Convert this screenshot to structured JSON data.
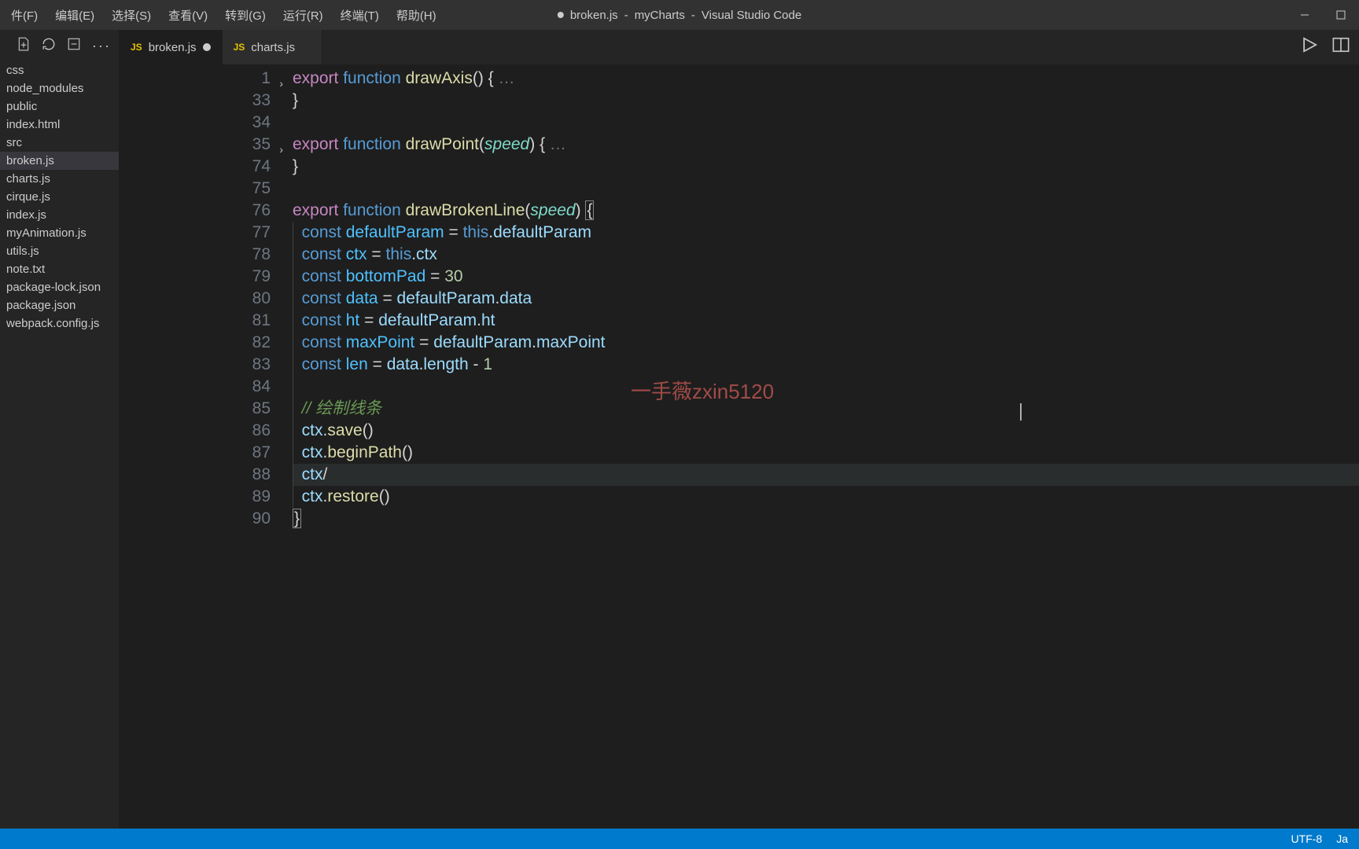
{
  "window": {
    "title_file": "broken.js",
    "title_project": "myCharts",
    "title_app": "Visual Studio Code",
    "dirty": true
  },
  "menu": [
    "件(F)",
    "编辑(E)",
    "选择(S)",
    "查看(V)",
    "转到(G)",
    "运行(R)",
    "终端(T)",
    "帮助(H)"
  ],
  "sidebar": {
    "files": [
      "css",
      "node_modules",
      "public",
      "  index.html",
      "src",
      "  broken.js",
      "  charts.js",
      "  cirque.js",
      "  index.js",
      "  myAnimation.js",
      "  utils.js",
      "note.txt",
      "package-lock.json",
      "package.json",
      "webpack.config.js"
    ],
    "active_index": 5
  },
  "tabs": [
    {
      "icon": "JS",
      "label": "broken.js",
      "dirty": true,
      "active": true
    },
    {
      "icon": "JS",
      "label": "charts.js",
      "dirty": false,
      "active": false
    }
  ],
  "code": {
    "lines": [
      {
        "num": 1,
        "fold": true,
        "tokens": [
          {
            "c": "kw",
            "t": "export"
          },
          {
            "c": "plain",
            "t": " "
          },
          {
            "c": "kw2",
            "t": "function"
          },
          {
            "c": "plain",
            "t": " "
          },
          {
            "c": "fn",
            "t": "drawAxis"
          },
          {
            "c": "punct",
            "t": "()"
          },
          {
            "c": "plain",
            "t": " "
          },
          {
            "c": "punct",
            "t": "{"
          },
          {
            "c": "fold",
            "t": " …"
          }
        ]
      },
      {
        "num": 33,
        "tokens": [
          {
            "c": "punct",
            "t": "}"
          }
        ]
      },
      {
        "num": 34,
        "tokens": []
      },
      {
        "num": 35,
        "fold": true,
        "tokens": [
          {
            "c": "kw",
            "t": "export"
          },
          {
            "c": "plain",
            "t": " "
          },
          {
            "c": "kw2",
            "t": "function"
          },
          {
            "c": "plain",
            "t": " "
          },
          {
            "c": "fn",
            "t": "drawPoint"
          },
          {
            "c": "punct",
            "t": "("
          },
          {
            "c": "param",
            "t": "speed"
          },
          {
            "c": "punct",
            "t": ")"
          },
          {
            "c": "plain",
            "t": " "
          },
          {
            "c": "punct",
            "t": "{"
          },
          {
            "c": "fold",
            "t": " …"
          }
        ]
      },
      {
        "num": 74,
        "tokens": [
          {
            "c": "punct",
            "t": "}"
          }
        ]
      },
      {
        "num": 75,
        "tokens": []
      },
      {
        "num": 76,
        "tokens": [
          {
            "c": "kw",
            "t": "export"
          },
          {
            "c": "plain",
            "t": " "
          },
          {
            "c": "kw2",
            "t": "function"
          },
          {
            "c": "plain",
            "t": " "
          },
          {
            "c": "fn",
            "t": "drawBrokenLine"
          },
          {
            "c": "punct",
            "t": "("
          },
          {
            "c": "param",
            "t": "speed"
          },
          {
            "c": "punct",
            "t": ")"
          },
          {
            "c": "plain",
            "t": " "
          },
          {
            "c": "punct",
            "t": "{",
            "hl": true
          }
        ]
      },
      {
        "num": 77,
        "indent": 1,
        "tokens": [
          {
            "c": "plain",
            "t": "  "
          },
          {
            "c": "kw2",
            "t": "const"
          },
          {
            "c": "plain",
            "t": " "
          },
          {
            "c": "var",
            "t": "defaultParam"
          },
          {
            "c": "plain",
            "t": " "
          },
          {
            "c": "op",
            "t": "="
          },
          {
            "c": "plain",
            "t": " "
          },
          {
            "c": "this",
            "t": "this"
          },
          {
            "c": "punct",
            "t": "."
          },
          {
            "c": "prop",
            "t": "defaultParam"
          }
        ]
      },
      {
        "num": 78,
        "indent": 1,
        "tokens": [
          {
            "c": "plain",
            "t": "  "
          },
          {
            "c": "kw2",
            "t": "const"
          },
          {
            "c": "plain",
            "t": " "
          },
          {
            "c": "var",
            "t": "ctx"
          },
          {
            "c": "plain",
            "t": " "
          },
          {
            "c": "op",
            "t": "="
          },
          {
            "c": "plain",
            "t": " "
          },
          {
            "c": "this",
            "t": "this"
          },
          {
            "c": "punct",
            "t": "."
          },
          {
            "c": "prop",
            "t": "ctx"
          }
        ]
      },
      {
        "num": 79,
        "indent": 1,
        "tokens": [
          {
            "c": "plain",
            "t": "  "
          },
          {
            "c": "kw2",
            "t": "const"
          },
          {
            "c": "plain",
            "t": " "
          },
          {
            "c": "var",
            "t": "bottomPad"
          },
          {
            "c": "plain",
            "t": " "
          },
          {
            "c": "op",
            "t": "="
          },
          {
            "c": "plain",
            "t": " "
          },
          {
            "c": "num",
            "t": "30"
          }
        ]
      },
      {
        "num": 80,
        "indent": 1,
        "tokens": [
          {
            "c": "plain",
            "t": "  "
          },
          {
            "c": "kw2",
            "t": "const"
          },
          {
            "c": "plain",
            "t": " "
          },
          {
            "c": "var",
            "t": "data"
          },
          {
            "c": "plain",
            "t": " "
          },
          {
            "c": "op",
            "t": "="
          },
          {
            "c": "plain",
            "t": " "
          },
          {
            "c": "prop",
            "t": "defaultParam"
          },
          {
            "c": "punct",
            "t": "."
          },
          {
            "c": "prop",
            "t": "data"
          }
        ]
      },
      {
        "num": 81,
        "indent": 1,
        "tokens": [
          {
            "c": "plain",
            "t": "  "
          },
          {
            "c": "kw2",
            "t": "const"
          },
          {
            "c": "plain",
            "t": " "
          },
          {
            "c": "var",
            "t": "ht"
          },
          {
            "c": "plain",
            "t": " "
          },
          {
            "c": "op",
            "t": "="
          },
          {
            "c": "plain",
            "t": " "
          },
          {
            "c": "prop",
            "t": "defaultParam"
          },
          {
            "c": "punct",
            "t": "."
          },
          {
            "c": "prop",
            "t": "ht"
          }
        ]
      },
      {
        "num": 82,
        "indent": 1,
        "tokens": [
          {
            "c": "plain",
            "t": "  "
          },
          {
            "c": "kw2",
            "t": "const"
          },
          {
            "c": "plain",
            "t": " "
          },
          {
            "c": "var",
            "t": "maxPoint"
          },
          {
            "c": "plain",
            "t": " "
          },
          {
            "c": "op",
            "t": "="
          },
          {
            "c": "plain",
            "t": " "
          },
          {
            "c": "prop",
            "t": "defaultParam"
          },
          {
            "c": "punct",
            "t": "."
          },
          {
            "c": "prop",
            "t": "maxPoint"
          }
        ]
      },
      {
        "num": 83,
        "indent": 1,
        "tokens": [
          {
            "c": "plain",
            "t": "  "
          },
          {
            "c": "kw2",
            "t": "const"
          },
          {
            "c": "plain",
            "t": " "
          },
          {
            "c": "var",
            "t": "len"
          },
          {
            "c": "plain",
            "t": " "
          },
          {
            "c": "op",
            "t": "="
          },
          {
            "c": "plain",
            "t": " "
          },
          {
            "c": "prop",
            "t": "data"
          },
          {
            "c": "punct",
            "t": "."
          },
          {
            "c": "prop",
            "t": "length"
          },
          {
            "c": "plain",
            "t": " "
          },
          {
            "c": "op",
            "t": "-"
          },
          {
            "c": "plain",
            "t": " "
          },
          {
            "c": "num",
            "t": "1"
          }
        ]
      },
      {
        "num": 84,
        "indent": 1,
        "tokens": []
      },
      {
        "num": 85,
        "indent": 1,
        "tokens": [
          {
            "c": "plain",
            "t": "  "
          },
          {
            "c": "comment",
            "t": "// 绘制线条"
          }
        ]
      },
      {
        "num": 86,
        "indent": 1,
        "tokens": [
          {
            "c": "plain",
            "t": "  "
          },
          {
            "c": "prop",
            "t": "ctx"
          },
          {
            "c": "punct",
            "t": "."
          },
          {
            "c": "fn",
            "t": "save"
          },
          {
            "c": "punct",
            "t": "()"
          }
        ]
      },
      {
        "num": 87,
        "indent": 1,
        "tokens": [
          {
            "c": "plain",
            "t": "  "
          },
          {
            "c": "prop",
            "t": "ctx"
          },
          {
            "c": "punct",
            "t": "."
          },
          {
            "c": "fn",
            "t": "beginPath"
          },
          {
            "c": "punct",
            "t": "()"
          }
        ]
      },
      {
        "num": 88,
        "indent": 1,
        "current": true,
        "tokens": [
          {
            "c": "plain",
            "t": "  "
          },
          {
            "c": "prop",
            "t": "ctx"
          },
          {
            "c": "op",
            "t": "/"
          }
        ]
      },
      {
        "num": 89,
        "indent": 1,
        "tokens": [
          {
            "c": "plain",
            "t": "  "
          },
          {
            "c": "prop",
            "t": "ctx"
          },
          {
            "c": "punct",
            "t": "."
          },
          {
            "c": "fn",
            "t": "restore"
          },
          {
            "c": "punct",
            "t": "()"
          }
        ]
      },
      {
        "num": 90,
        "tokens": [
          {
            "c": "punct",
            "t": "}",
            "hl": true
          }
        ]
      }
    ]
  },
  "watermark": "一手薇zxin5120",
  "statusbar": {
    "encoding": "UTF-8",
    "lang": "Ja"
  }
}
